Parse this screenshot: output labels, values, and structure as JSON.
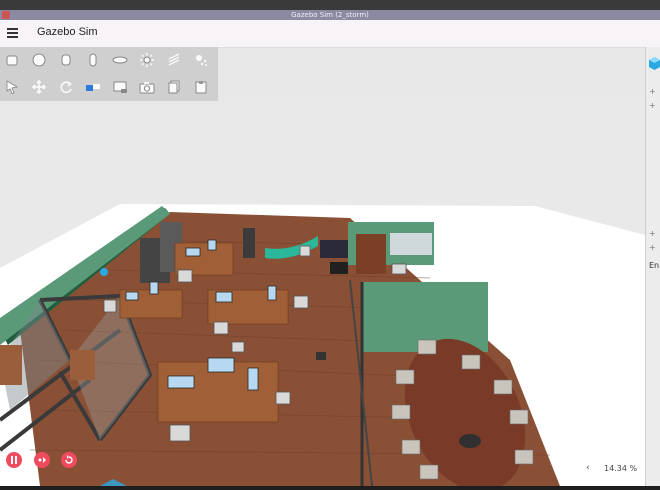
{
  "window": {
    "title": "Gazebo Sim (2_storm)"
  },
  "app": {
    "title": "Gazebo Sim"
  },
  "toolbar": {
    "row1": [
      "box-icon",
      "sphere-icon",
      "cylinder-icon",
      "capsule-icon",
      "ellipsoid-icon",
      "sun-light-icon",
      "directional-light-icon",
      "spot-light-icon"
    ],
    "row2": [
      "select-icon",
      "translate-icon",
      "rotate-icon",
      "view-angle-icon",
      "screenshot-camera-icon",
      "camera-icon",
      "copy-icon",
      "paste-icon"
    ]
  },
  "right_panel": {
    "plus1": "+",
    "plus2": "+",
    "plus3": "+",
    "plus4": "+",
    "label": "En"
  },
  "playback": {
    "zoom_label": "14.34 %",
    "arrow": "‹"
  },
  "colors": {
    "accent": "#f04a5e",
    "cube": "#2aa8e0",
    "floor": "#8a5036",
    "wall": "#5a9a78"
  }
}
